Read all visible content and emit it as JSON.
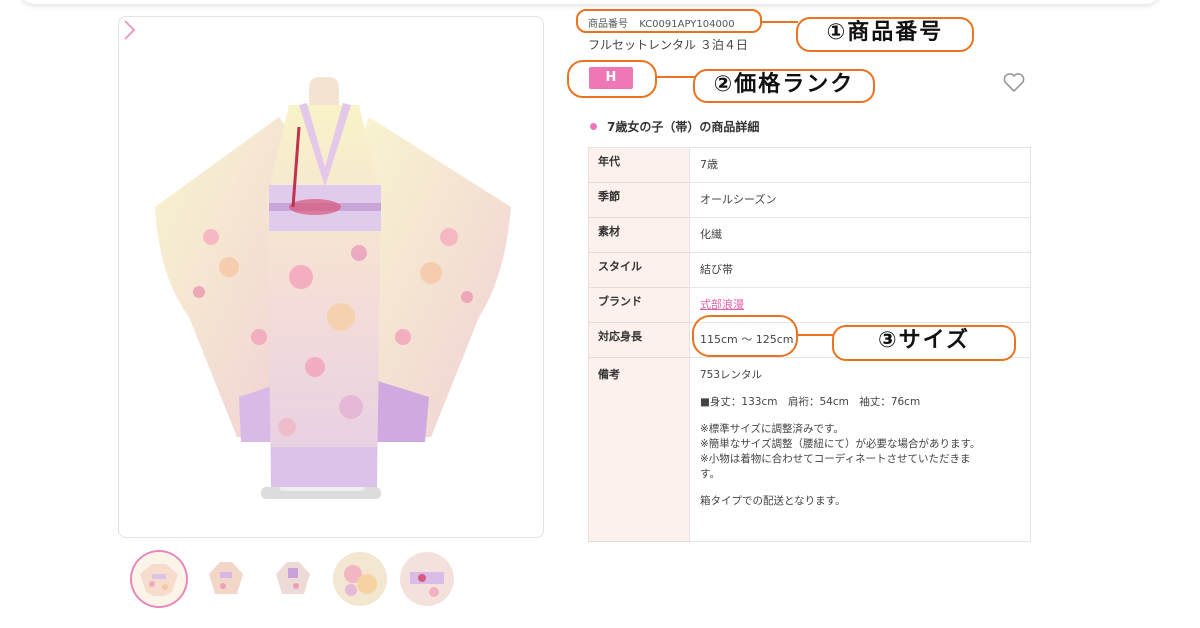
{
  "product": {
    "number_label": "商品番号",
    "number_value": "KC0091APY104000",
    "title": "フルセットレンタル ３泊４日",
    "rank": "H",
    "section_title": "7歳女の子（帯）の商品詳細"
  },
  "details": [
    {
      "label": "年代",
      "value": "7歳"
    },
    {
      "label": "季節",
      "value": "オールシーズン"
    },
    {
      "label": "素材",
      "value": "化繊"
    },
    {
      "label": "スタイル",
      "value": "結び帯"
    },
    {
      "label": "ブランド",
      "value": "式部浪漫"
    },
    {
      "label": "対応身長",
      "value": "115cm 〜 125cm"
    }
  ],
  "remarks": {
    "label": "備考",
    "lines": [
      "753レンタル",
      "■身丈：133cm　肩裄：54cm　袖丈：76cm",
      "※標準サイズに調整済みです。",
      "※簡単なサイズ調整（腰紐にて）が必要な場合があります。",
      "※小物は着物に合わせてコーディネートさせていただきま",
      "す。",
      "箱タイプでの配送となります。"
    ]
  },
  "annotations": {
    "callout_1": "①商品番号",
    "callout_2": "②価格ランク",
    "callout_3": "③サイズ"
  },
  "icons": {
    "favorite": "heart-icon",
    "next": "chevron-right-icon"
  },
  "colors": {
    "accent_pink": "#ef77b5",
    "annotation_orange": "#e8741f",
    "label_bg": "#fcf1ec"
  }
}
